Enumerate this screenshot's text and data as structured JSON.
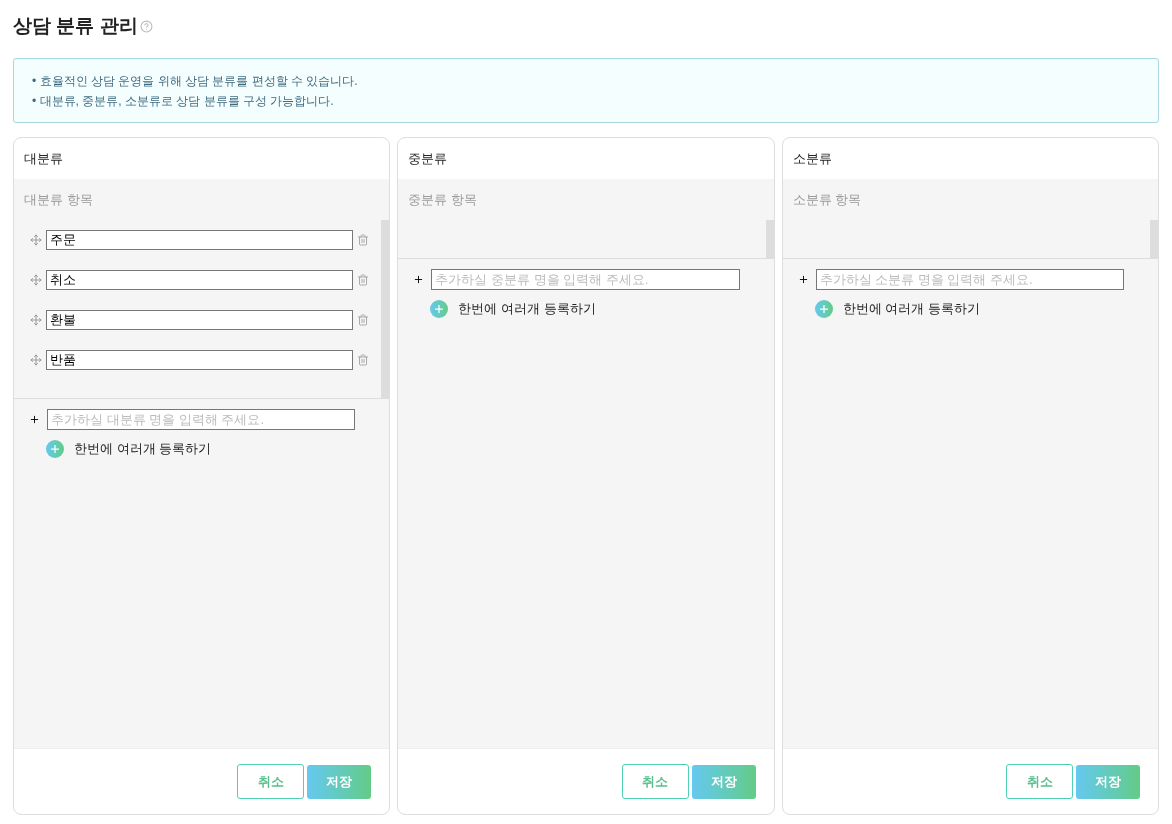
{
  "page": {
    "title": "상담 분류 관리"
  },
  "notes": [
    "• 효율적인 상담 운영을 위해 상담 분류를 편성할 수 있습니다.",
    "• 대분류, 중분류, 소분류로 상담 분류를 구성 가능합니다."
  ],
  "columns": [
    {
      "header": "대분류",
      "list_label": "대분류 항목",
      "items": [
        {
          "value": "주문"
        },
        {
          "value": "취소"
        },
        {
          "value": "환불"
        },
        {
          "value": "반품"
        }
      ],
      "add_placeholder": "추가하실 대분류 명을 입력해 주세요.",
      "bulk_add_label": "한번에 여러개 등록하기",
      "cancel_label": "취소",
      "save_label": "저장"
    },
    {
      "header": "중분류",
      "list_label": "중분류 항목",
      "add_placeholder": "추가하실 중분류 명을 입력해 주세요.",
      "bulk_add_label": "한번에 여러개 등록하기",
      "cancel_label": "취소",
      "save_label": "저장"
    },
    {
      "header": "소분류",
      "list_label": "소분류 항목",
      "add_placeholder": "추가하실 소분류 명을 입력해 주세요.",
      "bulk_add_label": "한번에 여러개 등록하기",
      "cancel_label": "취소",
      "save_label": "저장"
    }
  ]
}
